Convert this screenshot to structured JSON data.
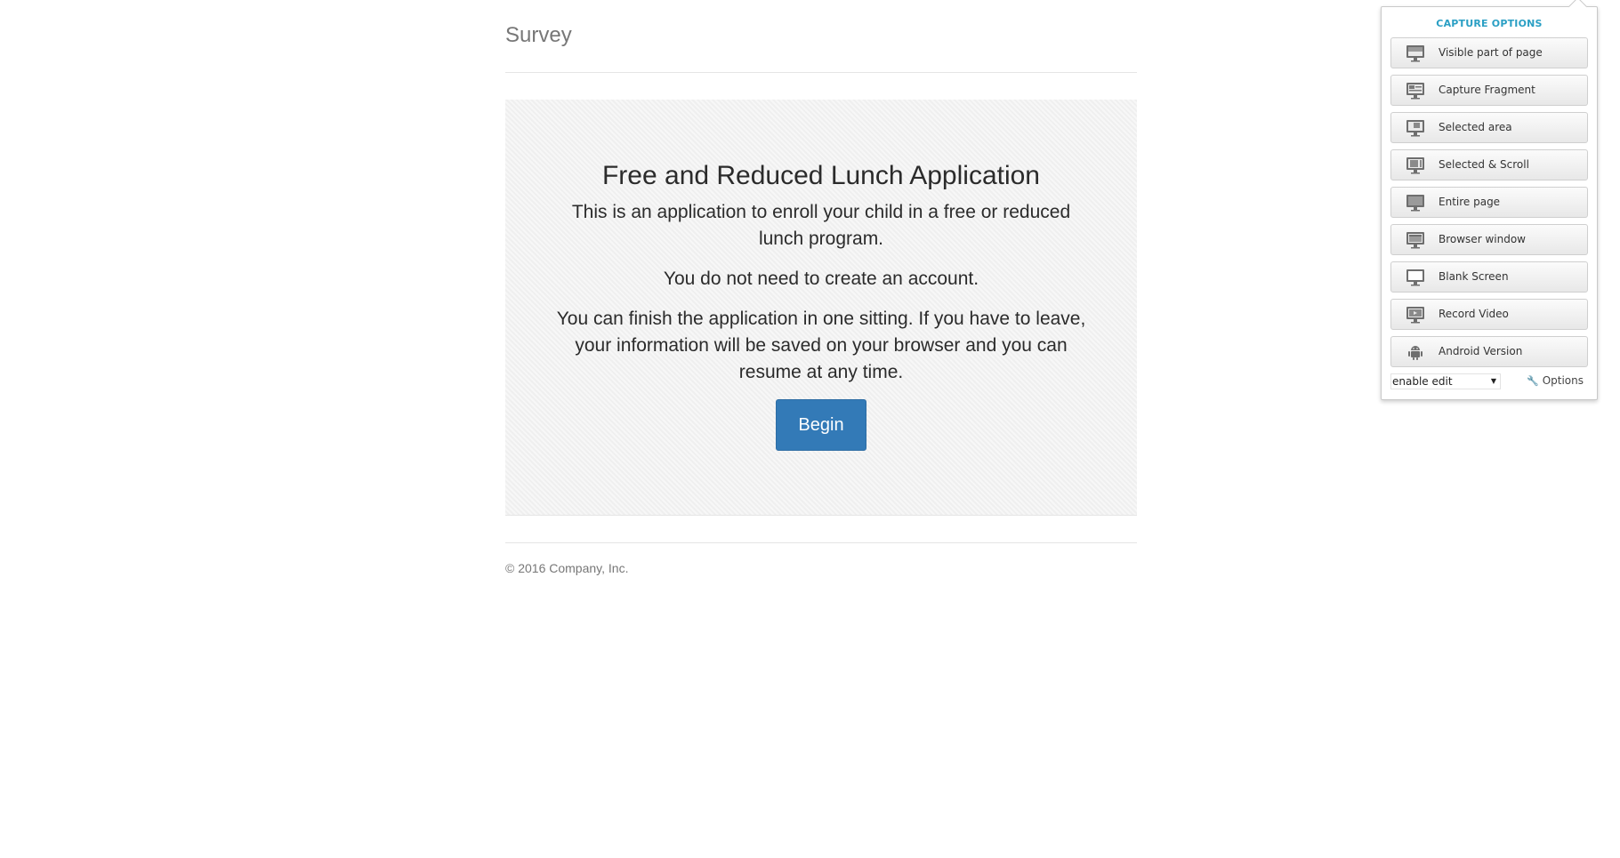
{
  "header": {
    "brand": "Survey"
  },
  "jumbotron": {
    "title": "Free and Reduced Lunch Application",
    "paragraphs": [
      "This is an application to enroll your child in a free or reduced lunch program.",
      "You do not need to create an account.",
      "You can finish the application in one sitting. If you have to leave, your information will be saved on your browser and you can resume at any time."
    ],
    "begin_label": "Begin"
  },
  "footer": {
    "copyright": "© 2016 Company, Inc."
  },
  "capture_panel": {
    "title": "CAPTURE OPTIONS",
    "items": [
      {
        "label": "Visible part of page",
        "icon": "monitor-visible-icon"
      },
      {
        "label": "Capture Fragment",
        "icon": "monitor-fragment-icon"
      },
      {
        "label": "Selected area",
        "icon": "monitor-selected-icon"
      },
      {
        "label": "Selected & Scroll",
        "icon": "monitor-scroll-icon"
      },
      {
        "label": "Entire page",
        "icon": "monitor-entire-icon"
      },
      {
        "label": "Browser window",
        "icon": "monitor-window-icon"
      },
      {
        "label": "Blank Screen",
        "icon": "monitor-blank-icon"
      },
      {
        "label": "Record Video",
        "icon": "monitor-video-icon"
      },
      {
        "label": "Android Version",
        "icon": "android-icon"
      }
    ],
    "edit_select_value": "enable edit",
    "options_label": "Options"
  },
  "colors": {
    "accent": "#2a9fc4",
    "primary_button": "#337ab7"
  }
}
